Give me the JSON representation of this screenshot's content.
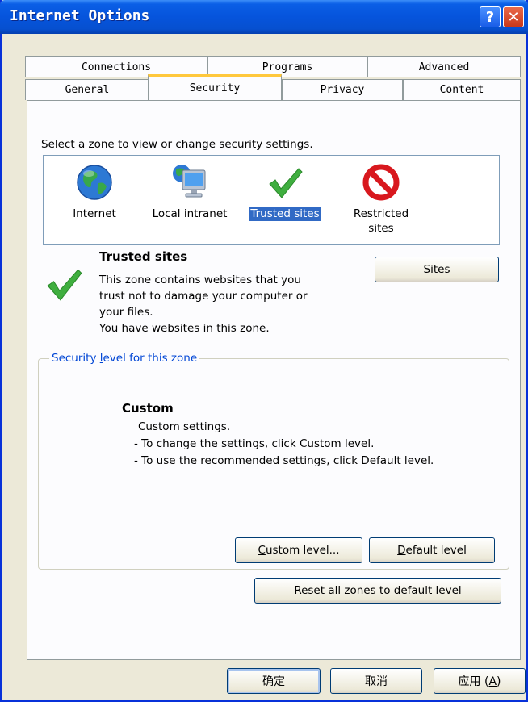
{
  "window": {
    "title": "Internet Options"
  },
  "titlebar": {
    "help_glyph": "?",
    "close_glyph": "✕"
  },
  "tabs": {
    "back_row": [
      "Connections",
      "Programs",
      "Advanced"
    ],
    "front_row": [
      "General",
      "Security",
      "Privacy",
      "Content"
    ],
    "active": "Security"
  },
  "security": {
    "prompt": "Select a zone to view or change security settings.",
    "zones": [
      {
        "icon": "globe-icon",
        "label": "Internet"
      },
      {
        "icon": "monitor-icon",
        "label": "Local intranet"
      },
      {
        "icon": "checkmark-icon",
        "label": "Trusted sites",
        "selected": true
      },
      {
        "icon": "no-entry-icon",
        "label_line1": "Restricted",
        "label_line2": "sites"
      }
    ],
    "zone_info": {
      "title": "Trusted sites",
      "desc_line1": "This zone contains websites that you",
      "desc_line2": "trust not to damage your computer or",
      "desc_line3": "your files.",
      "desc_line4": "You have websites in this zone."
    },
    "sites_button": {
      "accel": "S",
      "rest": "ites"
    },
    "level_group": {
      "title_pre": "Security ",
      "title_accel": "l",
      "title_post": "evel for this zone",
      "level_name": "Custom",
      "line1": "Custom settings.",
      "line2": "- To change the settings, click Custom level.",
      "line3": "- To use the recommended settings, click Default level."
    },
    "custom_level_button": {
      "accel": "C",
      "rest": "ustom level..."
    },
    "default_level_button": {
      "accel": "D",
      "rest": "efault level"
    },
    "reset_button": {
      "accel": "R",
      "rest": "eset all zones to default level"
    }
  },
  "footer": {
    "ok": "确定",
    "cancel": "取消",
    "apply_pre": "应用 (",
    "apply_accel": "A",
    "apply_post": ")"
  },
  "colors": {
    "accent_green": "#3fae3f",
    "restricted_red": "#d8181e",
    "selection_blue": "#316ac5",
    "group_title_blue": "#0046d5"
  }
}
